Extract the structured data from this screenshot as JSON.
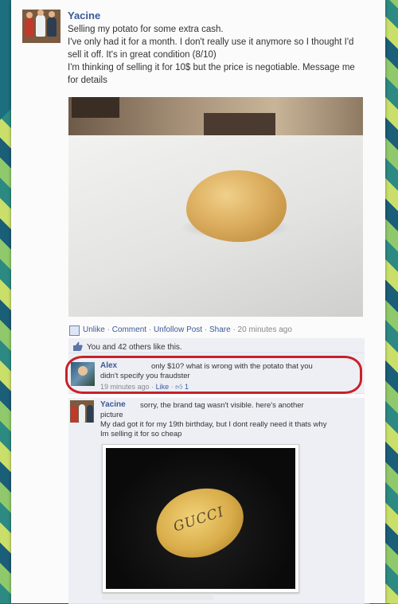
{
  "post": {
    "author": "Yacine",
    "lines": [
      "Selling my potato for some extra cash.",
      "I've only had it for a month. I don't really use it anymore so I thought I'd",
      "sell it off. It's in great condition (8/10)",
      "I'm thinking of selling it for 10$ but the price is negotiable. Message me",
      "for details"
    ],
    "actions": {
      "unlike": "Unlike",
      "comment": "Comment",
      "unfollow": "Unfollow Post",
      "share": "Share",
      "time": "20 minutes ago"
    },
    "likes": "You and 42 others like this."
  },
  "comments": [
    {
      "author": "Alex",
      "text_line1": "only $10? what is wrong with the potato that you",
      "text_line2": "didn't specify you fraudster",
      "time": "19 minutes ago",
      "like_label": "Like",
      "like_count": "1"
    },
    {
      "author": "Yacine",
      "text_line1": "sorry, the brand tag wasn't visible. here's another",
      "text_line2": "picture",
      "text_line3": "My dad got it for my 19th birthday, but I dont really need it thats why",
      "text_line4": "Im selling it for so cheap"
    }
  ],
  "photo2_label": "GUCCI",
  "colors": {
    "link": "#3b5998",
    "highlight": "#c8202a",
    "bar": "#edeff4"
  }
}
